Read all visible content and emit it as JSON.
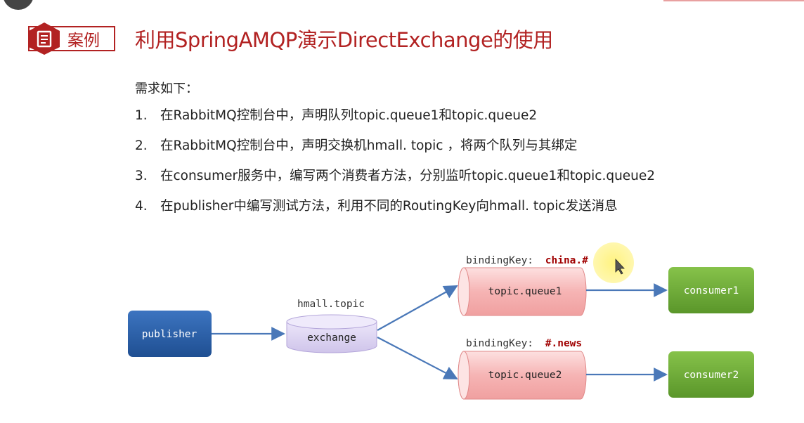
{
  "header": {
    "badge_label": "案例",
    "title": "利用SpringAMQP演示DirectExchange的使用"
  },
  "requirements": {
    "heading": "需求如下：",
    "items": [
      {
        "num": "1.",
        "text": "在RabbitMQ控制台中，声明队列topic.queue1和topic.queue2"
      },
      {
        "num": "2.",
        "text": "在RabbitMQ控制台中，声明交换机hmall. topic ，将两个队列与其绑定"
      },
      {
        "num": "3.",
        "text": "在consumer服务中，编写两个消费者方法，分别监听topic.queue1和topic.queue2"
      },
      {
        "num": "4.",
        "text": "在publisher中编写测试方法，利用不同的RoutingKey向hmall. topic发送消息"
      }
    ]
  },
  "diagram": {
    "publisher": "publisher",
    "exchange_name": "hmall.topic",
    "exchange": "exchange",
    "queue1": "topic.queue1",
    "queue2": "topic.queue2",
    "binding_prefix": "bindingKey:",
    "binding_key1": "china.#",
    "binding_key2": "#.news",
    "consumer1": "consumer1",
    "consumer2": "consumer2"
  },
  "colors": {
    "accent": "#b22222",
    "publisher": "#2a5fa8",
    "exchange": "#d9d0f0",
    "queue": "#f6b8b8",
    "consumer": "#6aa634",
    "arrow": "#4a78b8",
    "binding_key": "#a00000"
  }
}
